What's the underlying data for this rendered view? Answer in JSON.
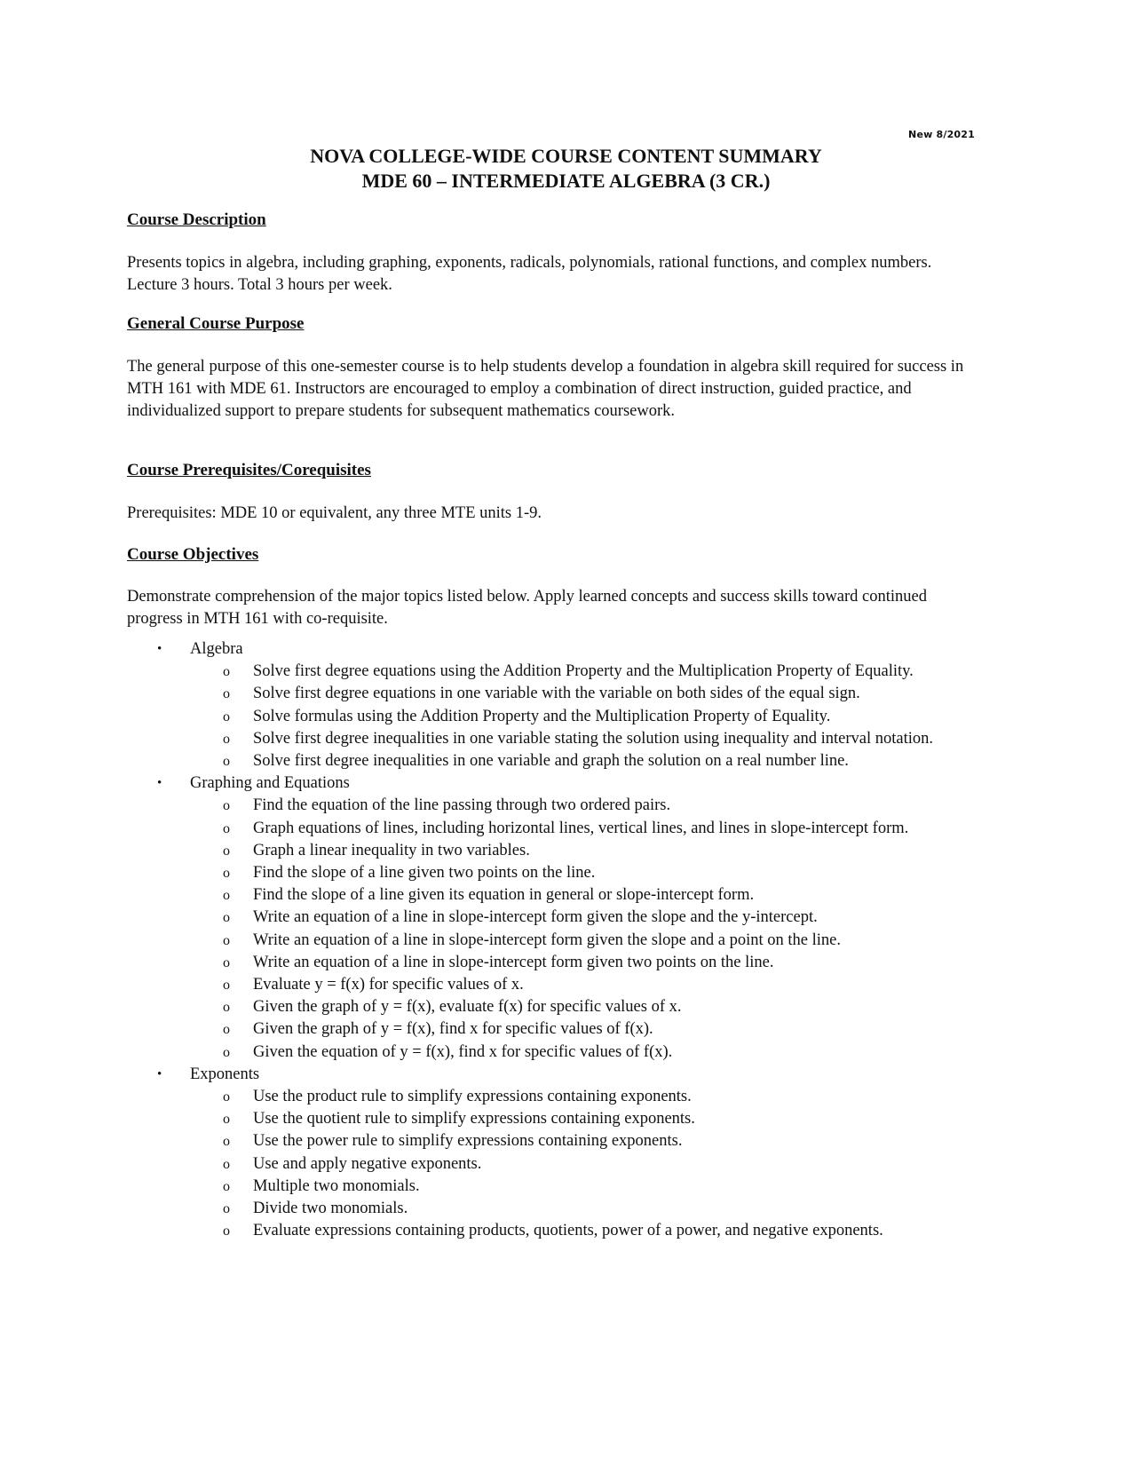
{
  "stamp": "New 8/2021",
  "title_line1": "NOVA COLLEGE-WIDE COURSE CONTENT SUMMARY",
  "title_line2": "MDE 60 – INTERMEDIATE ALGEBRA (3 CR.)",
  "sections": {
    "description": {
      "heading": "Course Description",
      "text": "Presents topics in algebra, including graphing, exponents, radicals, polynomials, rational functions, and complex numbers. Lecture 3 hours. Total 3 hours per week."
    },
    "purpose": {
      "heading": "General Course Purpose",
      "text": "The general purpose of this one-semester course is to help students develop a foundation in algebra skill required for success in MTH 161 with MDE 61. Instructors are encouraged to employ a combination of direct instruction, guided practice, and individualized support to prepare students for subsequent mathematics coursework."
    },
    "prereqs": {
      "heading": "Course Prerequisites/Corequisites",
      "text": "Prerequisites: MDE 10 or equivalent, any three MTE units 1-9."
    },
    "objectives": {
      "heading": "Course Objectives",
      "text": "Demonstrate comprehension of the major topics listed below.  Apply learned concepts and success skills toward continued progress in MTH 161 with co-requisite."
    }
  },
  "topics": [
    {
      "label": "Algebra",
      "items": [
        "Solve first degree equations using the Addition Property and the Multiplication Property of Equality.",
        "Solve first degree equations in one variable with the variable on both sides of the equal sign.",
        "Solve formulas using the Addition Property and the Multiplication Property of Equality.",
        "Solve first degree inequalities in one variable stating the solution using inequality and interval notation.",
        "Solve first degree inequalities in one variable and graph the solution on a real number line."
      ]
    },
    {
      "label": "Graphing and Equations",
      "items": [
        "Find the equation of the line passing through two ordered pairs.",
        "Graph equations of lines, including horizontal lines, vertical lines, and lines in slope-intercept form.",
        "Graph a linear inequality in two variables.",
        "Find the slope of a line given two points on the line.",
        "Find the slope of a line given its equation in general or slope-intercept form.",
        "Write an equation of a line in slope-intercept form given the slope and the y-intercept.",
        "Write an equation of a line in slope-intercept form given the slope and a point on the line.",
        "Write an equation of a line in slope-intercept form given two points on the line.",
        "Evaluate y = f(x) for specific values of x.",
        "Given the graph of y = f(x), evaluate f(x) for specific values of x.",
        "Given the graph of y = f(x), find x for specific values of f(x).",
        "Given the equation of y = f(x), find x for specific values of f(x)."
      ]
    },
    {
      "label": "Exponents",
      "items": [
        "Use the product rule to simplify expressions containing exponents.",
        "Use the quotient rule to simplify expressions containing exponents.",
        "Use the power rule to simplify expressions containing exponents.",
        "Use and apply negative exponents.",
        "Multiple two monomials.",
        "Divide two monomials.",
        "Evaluate expressions containing products, quotients, power of a power, and negative exponents."
      ]
    }
  ],
  "bullet_glyph": "•",
  "sub_bullet_glyph": "o"
}
